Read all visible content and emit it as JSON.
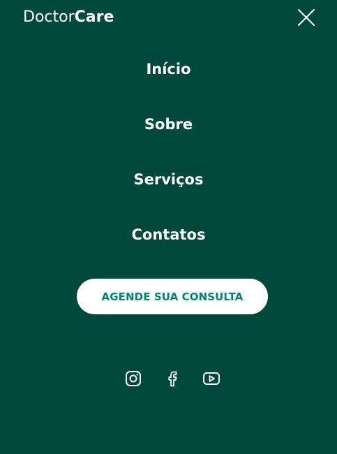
{
  "logo": {
    "part1": "Doctor",
    "part2": "Care"
  },
  "menu": {
    "items": [
      {
        "label": "Início"
      },
      {
        "label": "Sobre"
      },
      {
        "label": "Serviços"
      },
      {
        "label": "Contatos"
      }
    ],
    "cta_label": "AGENDE SUA CONSULTA"
  },
  "social": {
    "icons": [
      "instagram-icon",
      "facebook-icon",
      "youtube-icon"
    ]
  },
  "colors": {
    "background": "#00483C",
    "text": "#FFFFFF",
    "cta_text": "#00856F",
    "cta_background": "#FFFFFF"
  },
  "icons": {
    "close": "close-icon"
  }
}
